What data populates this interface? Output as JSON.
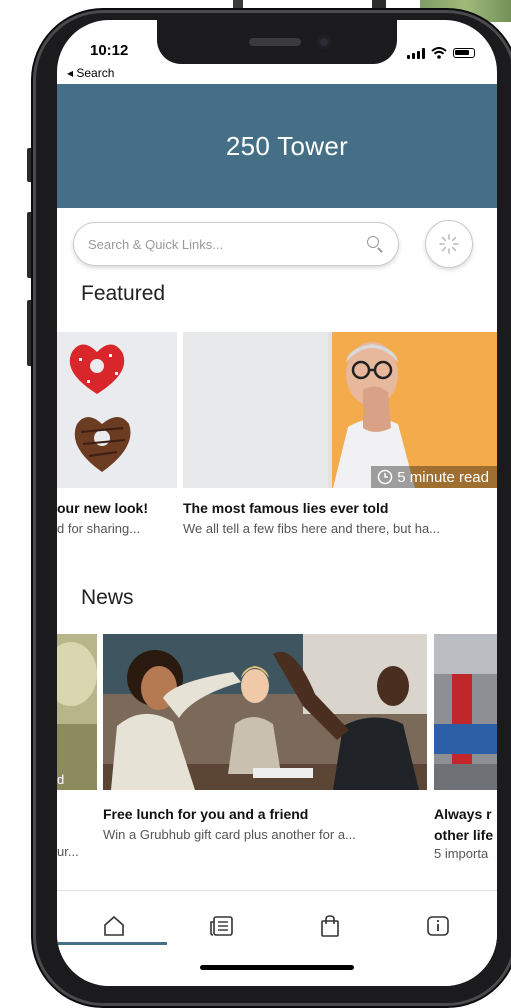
{
  "status": {
    "time": "10:12",
    "back": "◂ Search"
  },
  "header": {
    "title": "250 Tower"
  },
  "search": {
    "placeholder": "Search & Quick Links..."
  },
  "featured": {
    "title": "Featured",
    "cards": [
      {
        "title": "our new look!",
        "subtitle": "d for sharing..."
      },
      {
        "title": "The most famous lies ever told",
        "subtitle": "We all tell a few fibs here and there, but ha...",
        "badge": "5 minute read"
      }
    ]
  },
  "news": {
    "title": "News",
    "cards": [
      {
        "label": "d",
        "subtitle": "ur..."
      },
      {
        "title": "Free lunch for you and a friend",
        "subtitle": "Win a Grubhub gift card plus another for a..."
      },
      {
        "title": "Always r",
        "title2": "other life",
        "subtitle": "5 importa"
      }
    ]
  },
  "colors": {
    "header": "#456f86",
    "indicator": "#456f86"
  },
  "tabs": [
    {
      "icon": "home-icon"
    },
    {
      "icon": "news-icon"
    },
    {
      "icon": "shopping-bag-icon"
    },
    {
      "icon": "info-icon"
    }
  ]
}
